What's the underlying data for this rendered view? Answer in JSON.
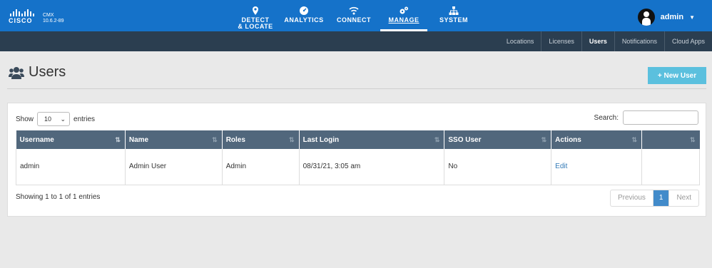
{
  "brand": {
    "name": "CISCO",
    "product": "CMX",
    "version": "10.6.2-89"
  },
  "nav": [
    {
      "line1": "DETECT",
      "line2": "& LOCATE",
      "icon": "map-pin-icon"
    },
    {
      "line1": "ANALYTICS",
      "line2": "",
      "icon": "dashboard-icon"
    },
    {
      "line1": "CONNECT",
      "line2": "",
      "icon": "wifi-icon"
    },
    {
      "line1": "MANAGE",
      "line2": "",
      "icon": "gears-icon"
    },
    {
      "line1": "SYSTEM",
      "line2": "",
      "icon": "sitemap-icon"
    }
  ],
  "user": {
    "name": "admin"
  },
  "subnav": [
    "Locations",
    "Licenses",
    "Users",
    "Notifications",
    "Cloud Apps"
  ],
  "page": {
    "title": "Users",
    "new_user_label": "+ New User"
  },
  "table_controls": {
    "show_label": "Show",
    "length_value": "10",
    "entries_label": "entries",
    "search_label": "Search:"
  },
  "table": {
    "columns": [
      "Username",
      "Name",
      "Roles",
      "Last Login",
      "SSO User",
      "Actions",
      ""
    ],
    "rows": [
      {
        "username": "admin",
        "name": "Admin User",
        "roles": "Admin",
        "last_login": "08/31/21, 3:05 am",
        "sso_user": "No",
        "action": "Edit"
      }
    ]
  },
  "footer": {
    "info": "Showing 1 to 1 of 1 entries",
    "previous": "Previous",
    "page": "1",
    "next": "Next"
  },
  "colors": {
    "topbar": "#1572c9",
    "subnav": "#2b3e50",
    "table_header": "#51677c",
    "new_user_button": "#5bc0de",
    "active_page": "#428bca"
  }
}
